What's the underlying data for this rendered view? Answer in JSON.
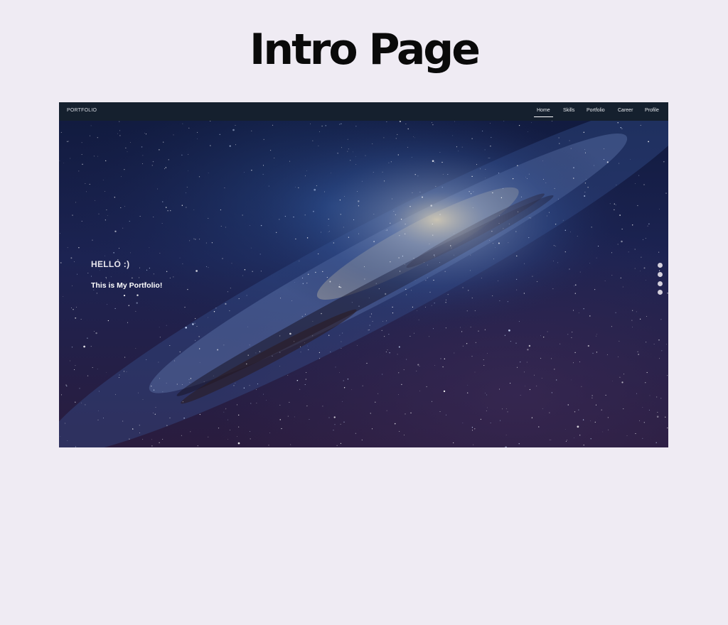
{
  "page": {
    "title": "Intro Page"
  },
  "site": {
    "brand": "PORTFOLIO",
    "nav": [
      {
        "label": "Home",
        "active": true
      },
      {
        "label": "Skills",
        "active": false
      },
      {
        "label": "Portfolio",
        "active": false
      },
      {
        "label": "Career",
        "active": false
      },
      {
        "label": "Profile",
        "active": false
      }
    ],
    "hero": {
      "greeting": "HELLO :)",
      "subtitle": "This is My Portfolio!",
      "background": "starry-night-milky-way"
    },
    "section_dots": {
      "count": 4,
      "active_index": 0
    }
  },
  "colors": {
    "page_background": "#efebf3",
    "navbar": "#15202e",
    "heading": "#0a0a0a",
    "hero_text": "#ffffff"
  }
}
